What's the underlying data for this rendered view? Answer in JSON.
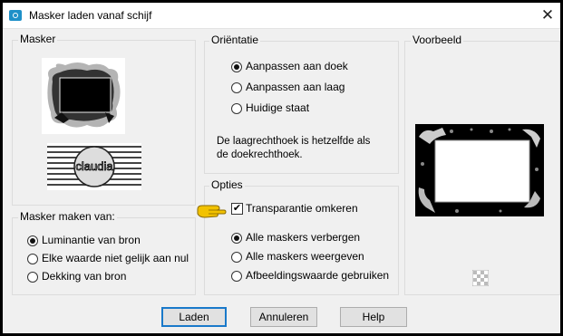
{
  "window": {
    "title": "Masker laden vanaf schijf",
    "close_glyph": "✕"
  },
  "mask_group": {
    "label": "Masker",
    "thumbnail_text": "claudia"
  },
  "source_group": {
    "label": "Masker maken van:",
    "options": [
      {
        "label": "Luminantie van bron",
        "selected": true
      },
      {
        "label": "Elke waarde niet gelijk aan nul",
        "selected": false
      },
      {
        "label": "Dekking van bron",
        "selected": false
      }
    ]
  },
  "orientation_group": {
    "label": "Oriëntatie",
    "options": [
      {
        "label": "Aanpassen aan doek",
        "selected": true
      },
      {
        "label": "Aanpassen aan laag",
        "selected": false
      },
      {
        "label": "Huidige staat",
        "selected": false
      }
    ],
    "info_line1": "De laagrechthoek is hetzelfde als",
    "info_line2": "de doekrechthoek."
  },
  "options_group": {
    "label": "Opties",
    "invert_label": "Transparantie omkeren",
    "invert_checked": true,
    "check_glyph": "✔",
    "options": [
      {
        "label": "Alle maskers verbergen",
        "selected": true
      },
      {
        "label": "Alle maskers weergeven",
        "selected": false
      },
      {
        "label": "Afbeeldingswaarde gebruiken",
        "selected": false
      }
    ]
  },
  "preview_group": {
    "label": "Voorbeeld"
  },
  "buttons": {
    "load": "Laden",
    "cancel": "Annuleren",
    "help": "Help"
  },
  "colors": {
    "accent": "#1979ca",
    "pointer_hand": "#f2c200"
  },
  "icons": {
    "pointer": "pointing-hand-icon",
    "transparency": "checkerboard-icon"
  }
}
